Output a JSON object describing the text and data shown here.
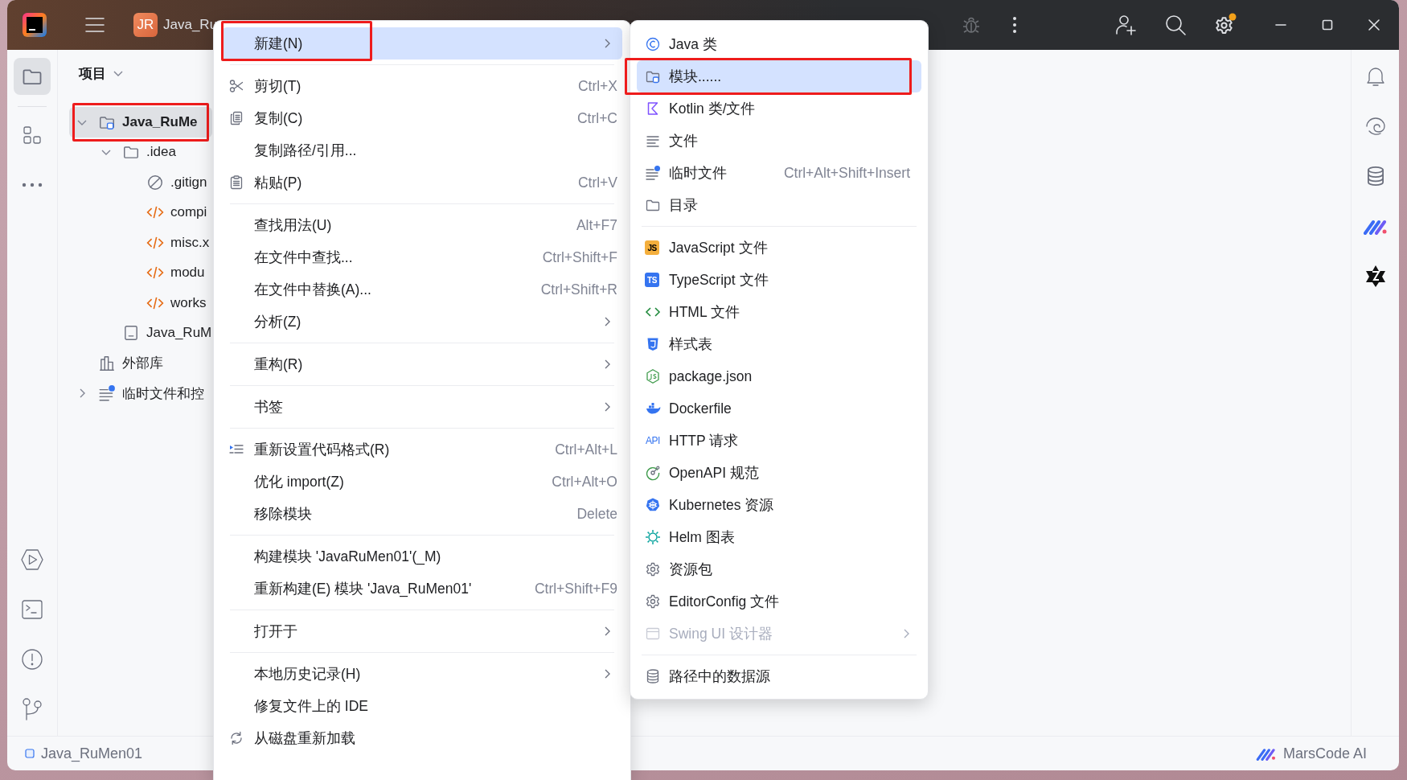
{
  "title_bar": {
    "project_badge": "JR",
    "project_name": "Java_Ru"
  },
  "project_panel": {
    "title": "项目",
    "tree": [
      {
        "kind": "module",
        "label": "Java_RuMe",
        "expanded": true,
        "selected": true,
        "marked": true,
        "children": [
          {
            "kind": "folder",
            "label": ".idea",
            "expanded": true,
            "selected": false,
            "children": [
              {
                "kind": "ignore",
                "label": ".gitign",
                "selected": false
              },
              {
                "kind": "xml",
                "label": "compi",
                "selected": false
              },
              {
                "kind": "xml",
                "label": "misc.x",
                "selected": false
              },
              {
                "kind": "xml",
                "label": "modu",
                "selected": false
              },
              {
                "kind": "xml",
                "label": "works",
                "selected": false
              }
            ]
          },
          {
            "kind": "iml",
            "label": "Java_RuM",
            "selected": false
          }
        ]
      },
      {
        "kind": "library",
        "label": "外部库",
        "selected": false
      },
      {
        "kind": "scratch",
        "label": "临时文件和控",
        "expanded": false,
        "selected": false
      }
    ]
  },
  "main_menu": {
    "groups": [
      [
        {
          "label": "新建(N)",
          "submenu": true,
          "selected": true,
          "marked": true
        }
      ],
      [
        {
          "label": "剪切(T)",
          "shortcut": "Ctrl+X",
          "selected": false
        },
        {
          "label": "复制(C)",
          "shortcut": "Ctrl+C",
          "selected": false
        },
        {
          "label": "复制路径/引用...",
          "selected": false
        },
        {
          "label": "粘贴(P)",
          "shortcut": "Ctrl+V",
          "selected": false
        }
      ],
      [
        {
          "label": "查找用法(U)",
          "shortcut": "Alt+F7",
          "selected": false
        },
        {
          "label": "在文件中查找...",
          "shortcut": "Ctrl+Shift+F",
          "selected": false
        },
        {
          "label": "在文件中替换(A)...",
          "shortcut": "Ctrl+Shift+R",
          "selected": false
        },
        {
          "label": "分析(Z)",
          "submenu": true,
          "selected": false
        }
      ],
      [
        {
          "label": "重构(R)",
          "submenu": true,
          "selected": false
        }
      ],
      [
        {
          "label": "书签",
          "submenu": true,
          "selected": false
        }
      ],
      [
        {
          "label": "重新设置代码格式(R)",
          "shortcut": "Ctrl+Alt+L",
          "selected": false
        },
        {
          "label": "优化 import(Z)",
          "shortcut": "Ctrl+Alt+O",
          "selected": false
        },
        {
          "label": "移除模块",
          "shortcut": "Delete",
          "selected": false
        }
      ],
      [
        {
          "label": "构建模块 'JavaRuMen01'(_M)",
          "selected": false
        },
        {
          "label": "重新构建(E) 模块 'Java_RuMen01'",
          "shortcut": "Ctrl+Shift+F9",
          "selected": false
        }
      ],
      [
        {
          "label": "打开于",
          "submenu": true,
          "selected": false
        }
      ],
      [
        {
          "label": "本地历史记录(H)",
          "submenu": true,
          "selected": false
        },
        {
          "label": "修复文件上的 IDE",
          "selected": false
        },
        {
          "label": "从磁盘重新加载",
          "selected": false
        }
      ]
    ]
  },
  "new_submenu": {
    "groups": [
      [
        {
          "label": "Java 类",
          "selected": false,
          "disabled": false
        },
        {
          "label": "模块......",
          "selected": true,
          "disabled": false,
          "marked": true
        },
        {
          "label": "Kotlin 类/文件",
          "selected": false,
          "disabled": false
        },
        {
          "label": "文件",
          "selected": false,
          "disabled": false
        },
        {
          "label": "临时文件",
          "shortcut": "Ctrl+Alt+Shift+Insert",
          "selected": false,
          "disabled": false
        },
        {
          "label": "目录",
          "selected": false,
          "disabled": false
        }
      ],
      [
        {
          "label": "JavaScript 文件",
          "badge": "JS",
          "selected": false,
          "disabled": false
        },
        {
          "label": "TypeScript 文件",
          "badge": "TS",
          "selected": false,
          "disabled": false
        },
        {
          "label": "HTML 文件",
          "selected": false,
          "disabled": false
        },
        {
          "label": "样式表",
          "selected": false,
          "disabled": false
        },
        {
          "label": "package.json",
          "selected": false,
          "disabled": false
        },
        {
          "label": "Dockerfile",
          "selected": false,
          "disabled": false
        },
        {
          "label": "HTTP 请求",
          "badge": "API",
          "selected": false,
          "disabled": false
        },
        {
          "label": "OpenAPI 规范",
          "selected": false,
          "disabled": false
        },
        {
          "label": "Kubernetes 资源",
          "selected": false,
          "disabled": false
        },
        {
          "label": "Helm 图表",
          "selected": false,
          "disabled": false
        },
        {
          "label": "资源包",
          "selected": false,
          "disabled": false
        },
        {
          "label": "EditorConfig 文件",
          "selected": false,
          "disabled": false
        },
        {
          "label": "Swing UI 设计器",
          "submenu": true,
          "selected": false,
          "disabled": true
        }
      ],
      [
        {
          "label": "路径中的数据源",
          "selected": false,
          "disabled": false
        }
      ]
    ]
  },
  "status_bar": {
    "project": "Java_RuMen01",
    "assistant": "MarsCode AI"
  }
}
